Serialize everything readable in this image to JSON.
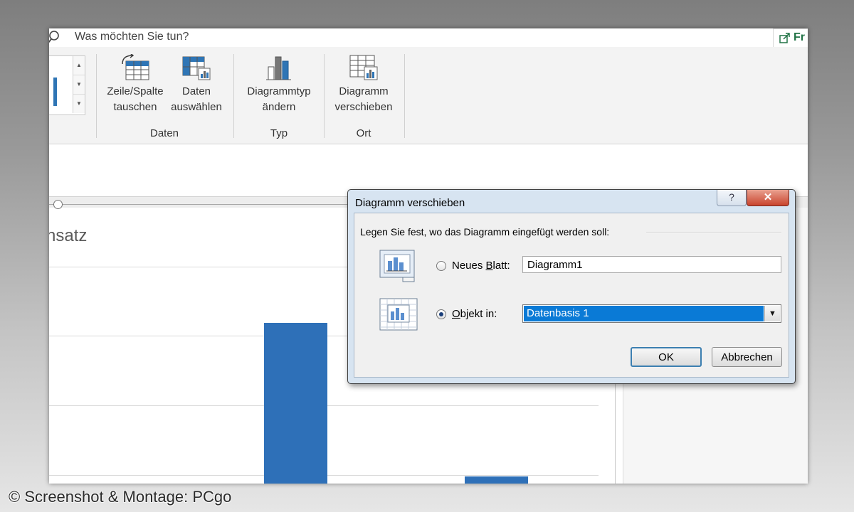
{
  "tell_me": {
    "placeholder": "Was möchten Sie tun?"
  },
  "share": {
    "label": "Fr"
  },
  "ribbon": {
    "buttons": {
      "switch_row_col": {
        "line1": "Zeile/Spalte",
        "line2": "tauschen"
      },
      "select_data": {
        "line1": "Daten",
        "line2": "auswählen"
      },
      "change_type": {
        "line1": "Diagrammtyp",
        "line2": "ändern"
      },
      "move_chart": {
        "line1": "Diagramm",
        "line2": "verschieben"
      }
    },
    "groups": {
      "data": "Daten",
      "type": "Typ",
      "location": "Ort"
    }
  },
  "chart": {
    "title_fragment": "nsatz",
    "accent_color": "#2e70b8"
  },
  "dialog": {
    "title": "Diagramm verschieben",
    "help": "?",
    "close": "✕",
    "prompt": "Legen Sie fest, wo das Diagramm eingefügt werden soll:",
    "options": {
      "new_sheet": {
        "label_pre": "Neues ",
        "label_key": "B",
        "label_post": "latt:",
        "value": "Diagramm1",
        "checked": false
      },
      "object_in": {
        "label_pre": "",
        "label_key": "O",
        "label_post": "bjekt in:",
        "value": "Datenbasis 1",
        "checked": true
      }
    },
    "ok": "OK",
    "cancel": "Abbrechen"
  },
  "watermark": "© Screenshot & Montage: PCgo"
}
